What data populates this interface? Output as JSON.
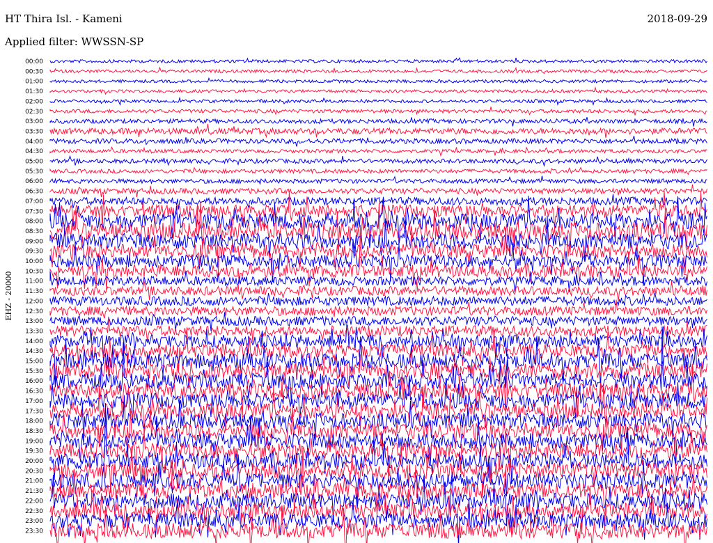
{
  "header": {
    "title": "HT Thira Isl. - Kameni",
    "date": "2018-09-29",
    "filter": "Applied filter: WWSSN-SP"
  },
  "colors": {
    "blue": "#0000ee",
    "red": "#ff1744",
    "background": "#ffffff",
    "text": "#000000"
  },
  "chart_data": {
    "type": "line",
    "title": "HT Thira Isl. - Kameni",
    "ylabel": "EHZ - 20000",
    "row_labels": [
      "00:00",
      "00:30",
      "01:00",
      "01:30",
      "02:00",
      "02:30",
      "03:00",
      "03:30",
      "04:00",
      "04:30",
      "05:00",
      "05:30",
      "06:00",
      "06:30",
      "07:00",
      "07:30",
      "08:00",
      "08:30",
      "09:00",
      "09:30",
      "10:00",
      "10:30",
      "11:00",
      "11:30",
      "12:00",
      "12:30",
      "13:00",
      "13:30",
      "14:00",
      "14:30",
      "15:00",
      "15:30",
      "16:00",
      "16:30",
      "17:00",
      "17:30",
      "18:00",
      "18:30",
      "19:00",
      "19:30",
      "20:00",
      "20:30",
      "21:00",
      "21:30",
      "22:00",
      "22:30",
      "23:00",
      "23:30"
    ],
    "series_colors_alternating": [
      "blue",
      "red"
    ],
    "relative_amplitude": [
      1,
      1,
      1,
      1,
      1,
      1.2,
      1.4,
      2,
      1.6,
      1.2,
      1.4,
      1.3,
      1.4,
      1.8,
      2.5,
      4,
      5,
      5.5,
      5,
      4.5,
      4,
      4,
      3,
      3,
      3,
      3,
      3,
      3.5,
      4,
      4.5,
      5,
      5,
      5,
      5,
      5,
      5,
      5,
      5,
      5,
      5,
      5,
      5,
      5,
      5,
      5,
      5,
      5,
      5
    ]
  }
}
